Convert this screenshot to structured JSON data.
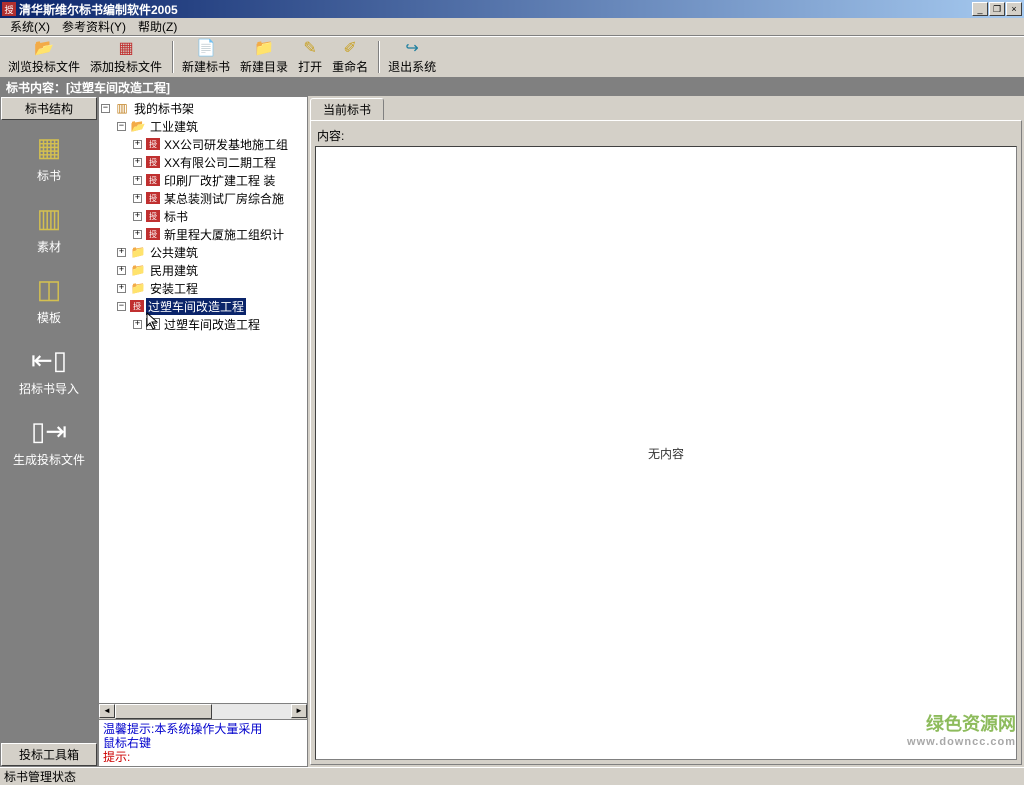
{
  "window": {
    "title": "清华斯维尔标书编制软件2005",
    "min": "_",
    "max": "❐",
    "close": "×"
  },
  "menu": {
    "system": "系统(X)",
    "reference": "参考资料(Y)",
    "help": "帮助(Z)"
  },
  "toolbar": {
    "browse": "浏览投标文件",
    "add": "添加投标文件",
    "newbook": "新建标书",
    "newdir": "新建目录",
    "open": "打开",
    "rename": "重命名",
    "exit": "退出系统"
  },
  "content_header": "标书内容：[过塑车间改造工程]",
  "sidebar": {
    "tab_struct": "标书结构",
    "tab_toolbox": "投标工具箱",
    "items": {
      "book": "标书",
      "material": "素材",
      "template": "模板",
      "import": "招标书导入",
      "generate": "生成投标文件"
    }
  },
  "tree": {
    "root": "我的标书架",
    "industrial": "工业建筑",
    "ind_items": [
      "XX公司研发基地施工组",
      "XX有限公司二期工程",
      "印刷厂改扩建工程 装",
      "某总装测试厂房综合施",
      "标书",
      "新里程大厦施工组织计"
    ],
    "public": "公共建筑",
    "residential": "民用建筑",
    "install": "安装工程",
    "selected": "过塑车间改造工程",
    "sel_child": "过塑车间改造工程"
  },
  "hint": {
    "line1": "温馨提示:本系统操作大量采用",
    "line2": "鼠标右键",
    "line3": "提示:"
  },
  "main": {
    "tab": "当前标书",
    "content_label": "内容:",
    "empty": "无内容"
  },
  "status": "标书管理状态",
  "watermark": {
    "main": "绿色资源网",
    "sub": "www.downcc.com"
  }
}
